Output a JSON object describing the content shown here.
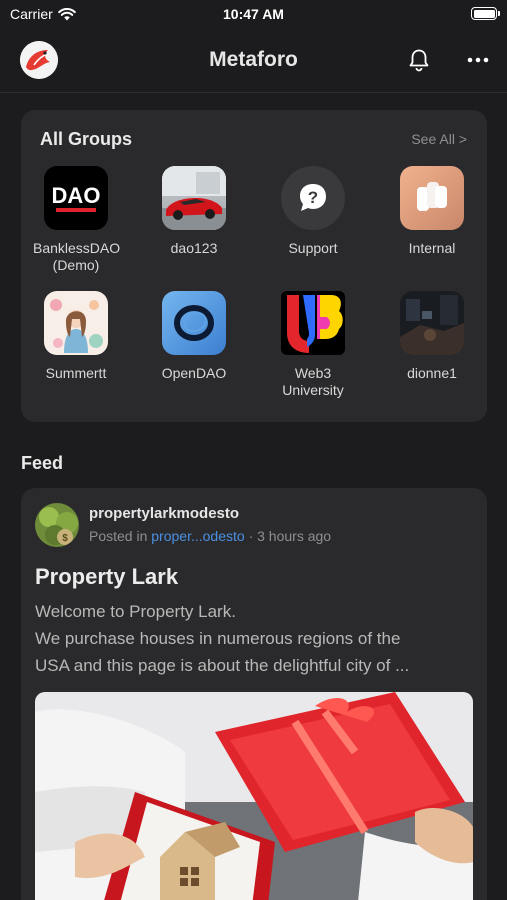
{
  "status_bar": {
    "carrier": "Carrier",
    "time": "10:47 AM"
  },
  "header": {
    "title": "Metaforo"
  },
  "groups": {
    "title": "All Groups",
    "see_all": "See All >",
    "items": [
      {
        "label": "BanklessDAO (Demo)",
        "icon": "dao-logo"
      },
      {
        "label": "dao123",
        "icon": "red-sports-car"
      },
      {
        "label": "Support",
        "icon": "question-mark"
      },
      {
        "label": "Internal",
        "icon": "blocks-logo"
      },
      {
        "label": "Summertt",
        "icon": "illustration-woman"
      },
      {
        "label": "OpenDAO",
        "icon": "opendao-ring-logo"
      },
      {
        "label": "Web3 University",
        "icon": "web3-university-logo"
      },
      {
        "label": "dionne1",
        "icon": "dark-photo"
      }
    ]
  },
  "feed": {
    "title": "Feed",
    "post": {
      "author": "propertylarkmodesto",
      "posted_prefix": "Posted in",
      "group": "proper...odesto",
      "time": "3 hours ago",
      "title": "Property Lark",
      "body": [
        "Welcome to Property Lark.",
        "We purchase houses in numerous regions of the",
        "USA and this page is about the delightful city of ..."
      ]
    }
  },
  "colors": {
    "background": "#1c1c1e",
    "card": "#2a2a2c",
    "link": "#4a90e2",
    "muted": "#8e8e93"
  }
}
